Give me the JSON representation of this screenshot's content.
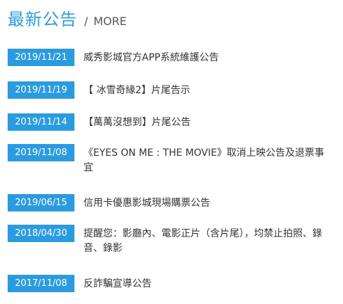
{
  "header": {
    "title": "最新公告",
    "separator": "/",
    "more_label": "MORE"
  },
  "announcements": [
    {
      "date": "2019/11/21",
      "title": "威秀影城官方APP系統維護公告"
    },
    {
      "date": "2019/11/19",
      "title": "【 冰雪奇緣2】片尾告示"
    },
    {
      "date": "2019/11/14",
      "title": "【萬萬沒想到】片尾公告"
    },
    {
      "date": "2019/11/08",
      "title": "《EYES ON ME : THE MOVIE》取消上映公告及退票事宜"
    },
    {
      "date": "2019/06/15",
      "title": "信用卡優惠影城現場購票公告"
    },
    {
      "date": "2018/04/30",
      "title": "提醒您：影廳內、電影正片（含片尾），均禁止拍照、錄音、錄影"
    },
    {
      "date": "2017/11/08",
      "title": "反詐騙宣導公告"
    }
  ],
  "colors": {
    "accent": "#2b9be0",
    "text": "#333333"
  }
}
